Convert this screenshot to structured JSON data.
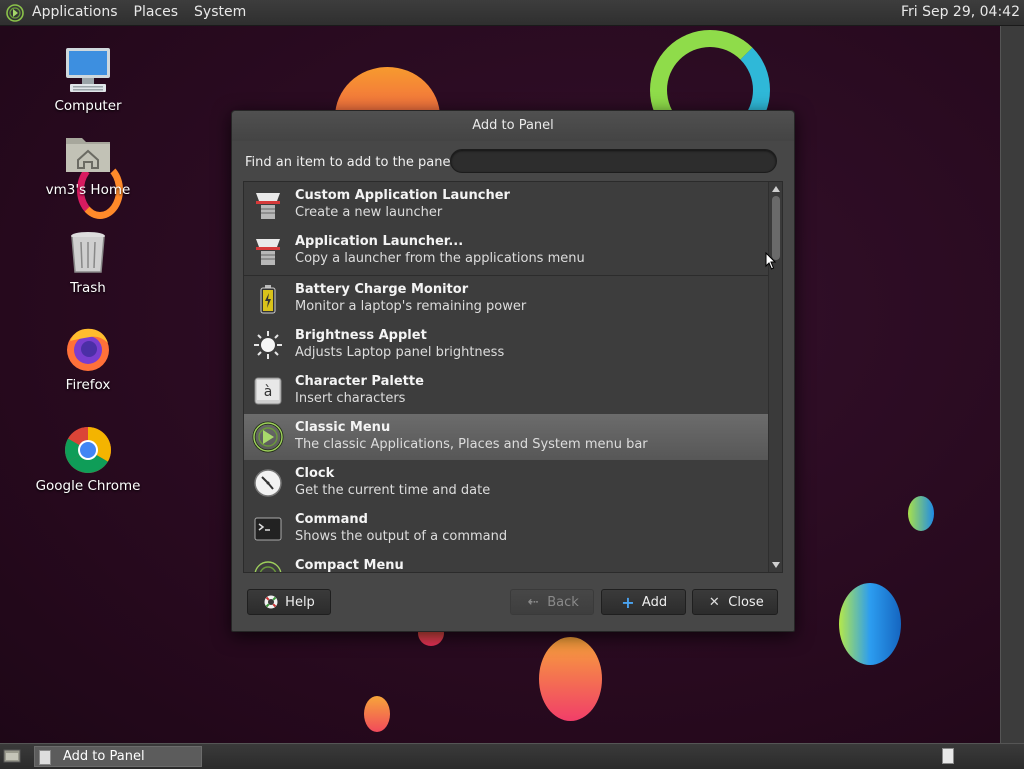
{
  "top_panel": {
    "menus": [
      "Applications",
      "Places",
      "System"
    ],
    "clock": "Fri Sep 29, 04:42"
  },
  "desktop_icons": [
    {
      "label": "Computer",
      "icon": "computer-icon"
    },
    {
      "label": "vm3's Home",
      "icon": "home-folder-icon"
    },
    {
      "label": "Trash",
      "icon": "trash-icon"
    },
    {
      "label": "Firefox",
      "icon": "firefox-icon"
    },
    {
      "label": "Google Chrome",
      "icon": "chrome-icon"
    }
  ],
  "dialog": {
    "title": "Add to Panel",
    "find_label": "Find an item to add to the panel:",
    "search_value": "",
    "items": [
      {
        "name": "Custom Application Launcher",
        "desc": "Create a new launcher",
        "icon": "launcher-icon"
      },
      {
        "name": "Application Launcher...",
        "desc": "Copy a launcher from the applications menu",
        "icon": "launcher-icon"
      },
      {
        "name": "Battery Charge Monitor",
        "desc": "Monitor a laptop's remaining power",
        "icon": "battery-icon"
      },
      {
        "name": "Brightness Applet",
        "desc": "Adjusts Laptop panel brightness",
        "icon": "brightness-icon"
      },
      {
        "name": "Character Palette",
        "desc": "Insert characters",
        "icon": "character-palette-icon"
      },
      {
        "name": "Classic Menu",
        "desc": "The classic Applications, Places and System menu bar",
        "icon": "classic-menu-icon",
        "selected": true
      },
      {
        "name": "Clock",
        "desc": "Get the current time and date",
        "icon": "clock-icon"
      },
      {
        "name": "Command",
        "desc": "Shows the output of a command",
        "icon": "terminal-icon"
      },
      {
        "name": "Compact Menu",
        "desc": "",
        "icon": "compact-menu-icon"
      }
    ],
    "buttons": {
      "help": "Help",
      "back": "Back",
      "add": "Add",
      "close": "Close"
    }
  },
  "taskbar": {
    "window_label": "Add to Panel"
  },
  "colors": {
    "desktop_bg": "#2a0f22",
    "dialog_bg": "#474747",
    "selected_row": "#606060"
  }
}
